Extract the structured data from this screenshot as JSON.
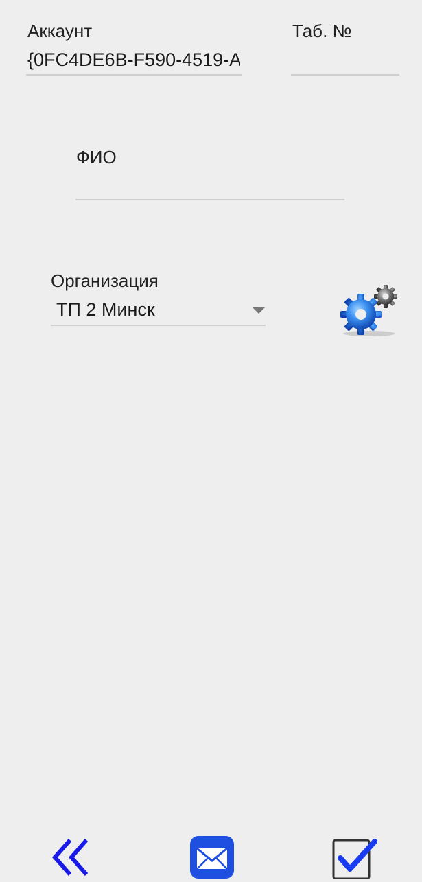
{
  "form": {
    "account_label": "Аккаунт",
    "account_value": "{0FC4DE6B-F590-4519-A",
    "tab_number_label": "Таб. №",
    "tab_number_value": "",
    "fio_label": "ФИО",
    "fio_value": "",
    "organization_label": "Организация",
    "organization_value": "ТП 2 Минск"
  },
  "icons": {
    "settings": "gears-settings-icon",
    "back": "double-chevron-left-icon",
    "mail": "envelope-icon",
    "confirm": "checkbox-checked-icon"
  },
  "colors": {
    "background": "#eeeeee",
    "accent_blue": "#1a3cf0",
    "mail_blue": "#1f4fe0"
  }
}
